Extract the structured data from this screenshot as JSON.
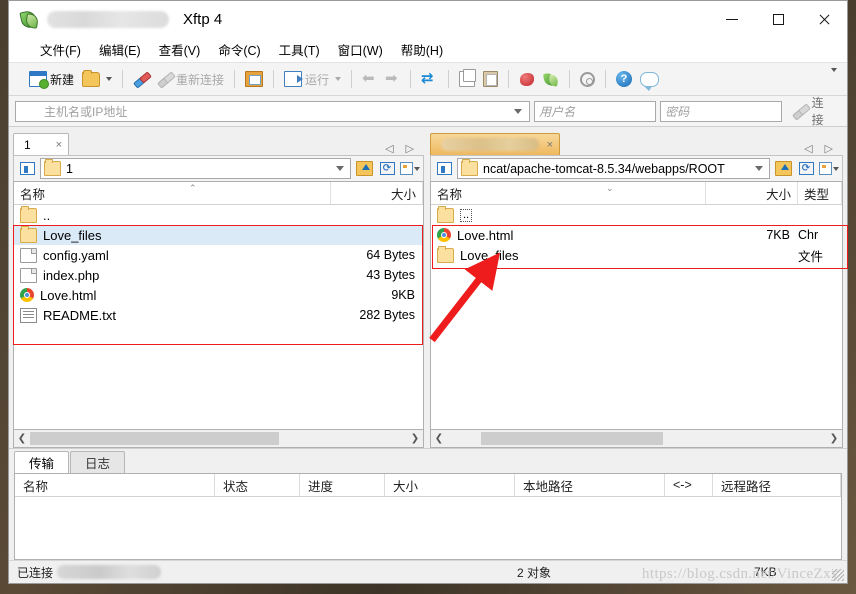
{
  "window": {
    "title": "Xftp 4",
    "icon": "xftp-leaf-icon",
    "controls": {
      "minimize": "—",
      "maximize": "□",
      "close": "✕"
    }
  },
  "menubar": {
    "items": [
      {
        "label": "文件(F)",
        "name": "menu-file"
      },
      {
        "label": "编辑(E)",
        "name": "menu-edit"
      },
      {
        "label": "查看(V)",
        "name": "menu-view"
      },
      {
        "label": "命令(C)",
        "name": "menu-command"
      },
      {
        "label": "工具(T)",
        "name": "menu-tools"
      },
      {
        "label": "窗口(W)",
        "name": "menu-window"
      },
      {
        "label": "帮助(H)",
        "name": "menu-help"
      }
    ]
  },
  "toolbar": {
    "new_label": "新建",
    "reconnect_label": "重新连接",
    "run_label": "运行",
    "overflow": "▾"
  },
  "connection_bar": {
    "host_placeholder": "主机名或IP地址",
    "username_placeholder": "用户名",
    "password_placeholder": "密码",
    "connect_label": "连接"
  },
  "left_pane": {
    "tab": {
      "label": "1",
      "close": "×"
    },
    "nav": {
      "prev": "◁",
      "next": "▷"
    },
    "path": "1",
    "columns": {
      "name": "名称",
      "size": "大小"
    },
    "rows": [
      {
        "icon": "folder-icon",
        "name": "..",
        "size": "",
        "selected": false
      },
      {
        "icon": "folder-icon",
        "name": "Love_files",
        "size": "",
        "selected": true
      },
      {
        "icon": "file-icon",
        "name": "config.yaml",
        "size": "64 Bytes",
        "selected": false
      },
      {
        "icon": "file-icon",
        "name": "index.php",
        "size": "43 Bytes",
        "selected": false
      },
      {
        "icon": "chrome-icon",
        "name": "Love.html",
        "size": "9KB",
        "selected": false
      },
      {
        "icon": "text-file-icon",
        "name": "README.txt",
        "size": "282 Bytes",
        "selected": false
      }
    ],
    "scroll": {
      "left": "❮",
      "right": "❯"
    }
  },
  "right_pane": {
    "tab": {
      "label": "",
      "close": "×",
      "blurred": true
    },
    "nav": {
      "prev": "◁",
      "next": "▷"
    },
    "path": "ncat/apache-tomcat-8.5.34/webapps/ROOT",
    "columns": {
      "name": "名称",
      "size": "大小",
      "type": "类型"
    },
    "rows": [
      {
        "icon": "folder-icon",
        "name": "..",
        "size": "",
        "type": "",
        "dotted": true
      },
      {
        "icon": "chrome-icon",
        "name": "Love.html",
        "size": "7KB",
        "type": "Chr"
      },
      {
        "icon": "folder-icon",
        "name": "Love_files",
        "size": "",
        "type": "文件"
      }
    ],
    "scroll": {
      "left": "❮",
      "right": "❯"
    }
  },
  "bottom_panel": {
    "tabs": [
      {
        "label": "传输",
        "active": true
      },
      {
        "label": "日志",
        "active": false
      }
    ],
    "columns": [
      "名称",
      "状态",
      "进度",
      "大小",
      "本地路径",
      "<->",
      "远程路径"
    ]
  },
  "statusbar": {
    "connected_label": "已连接",
    "object_count": "2 对象",
    "total_size": "7KB"
  },
  "watermark": "https://blog.csdn.net/VinceZxy",
  "colors": {
    "accent_blue": "#2f78c4",
    "selection": "#dbeaf7",
    "annotation_red": "#ee1c1c",
    "active_tab_orange": "#efb85f"
  }
}
